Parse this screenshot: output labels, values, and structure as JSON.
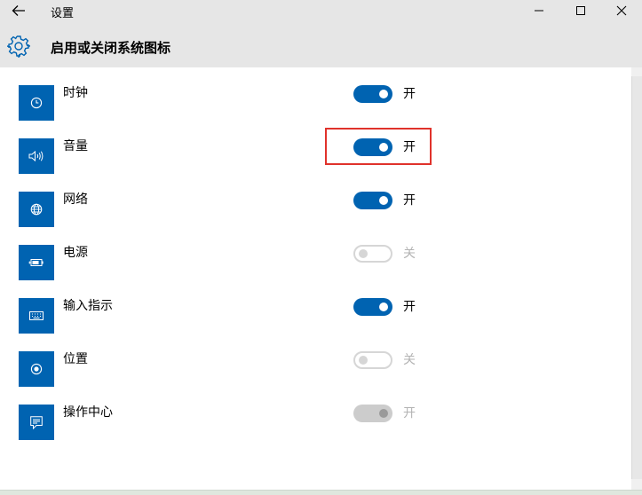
{
  "window": {
    "title": "设置",
    "back_icon": "back-arrow-icon",
    "minimize_icon": "minimize-icon",
    "maximize_icon": "maximize-icon",
    "close_icon": "close-icon"
  },
  "page": {
    "title": "启用或关闭系统图标",
    "icon": "gear-icon"
  },
  "items": [
    {
      "label": "时钟",
      "icon": "clock-icon",
      "on": true,
      "enabled": true,
      "state": "开"
    },
    {
      "label": "音量",
      "icon": "volume-icon",
      "on": true,
      "enabled": true,
      "state": "开",
      "highlighted": true
    },
    {
      "label": "网络",
      "icon": "globe-network-icon",
      "on": true,
      "enabled": true,
      "state": "开"
    },
    {
      "label": "电源",
      "icon": "battery-power-icon",
      "on": false,
      "enabled": false,
      "state": "关"
    },
    {
      "label": "输入指示",
      "icon": "keyboard-icon",
      "on": true,
      "enabled": true,
      "state": "开"
    },
    {
      "label": "位置",
      "icon": "location-icon",
      "on": false,
      "enabled": false,
      "state": "关"
    },
    {
      "label": "操作中心",
      "icon": "action-center-icon",
      "on": true,
      "enabled": false,
      "state": "开"
    }
  ],
  "colors": {
    "accent": "#0063b1",
    "titlebar": "#e6e6e6",
    "highlight_box": "#e0322b"
  }
}
